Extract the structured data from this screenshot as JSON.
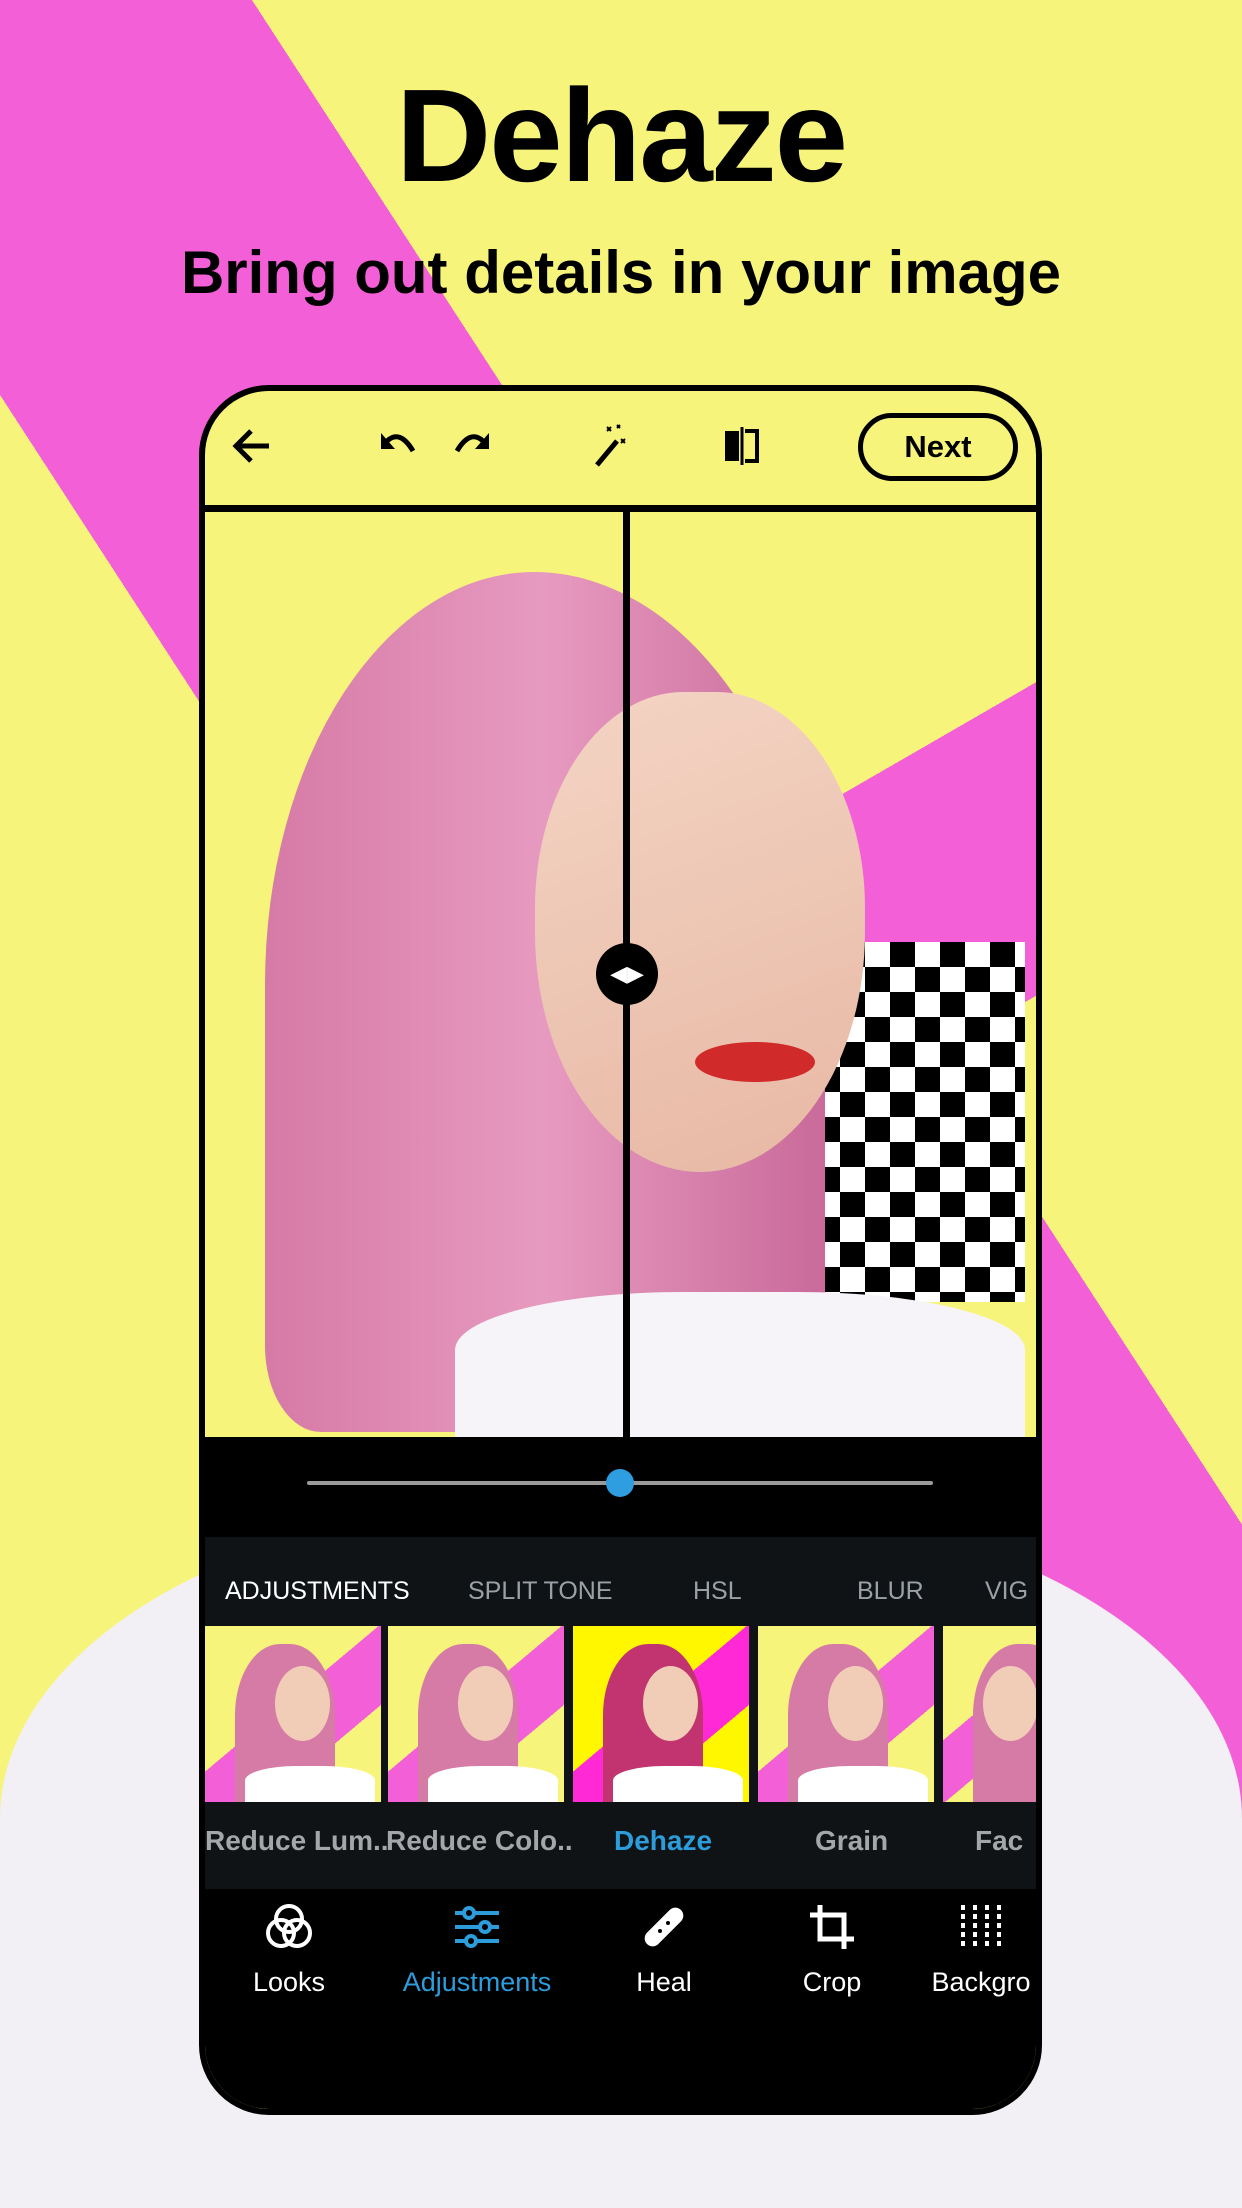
{
  "header": {
    "title": "Dehaze",
    "subtitle": "Bring out details in your image"
  },
  "toolbar": {
    "back_icon": "arrow-left-icon",
    "undo_icon": "undo-icon",
    "redo_icon": "redo-icon",
    "auto_icon": "magic-wand-icon",
    "compare_icon": "compare-icon",
    "next_label": "Next"
  },
  "slider": {
    "value_percent": 50,
    "accent": "#2f9ee0"
  },
  "tabs": [
    {
      "label": "ADJUSTMENTS",
      "active": true
    },
    {
      "label": "SPLIT TONE"
    },
    {
      "label": "HSL"
    },
    {
      "label": "BLUR"
    },
    {
      "label": "VIG"
    }
  ],
  "presets": [
    {
      "label": "Reduce Lum.."
    },
    {
      "label": "Reduce Colo.."
    },
    {
      "label": "Dehaze",
      "selected": true
    },
    {
      "label": "Grain"
    },
    {
      "label": "Fac"
    }
  ],
  "nav": [
    {
      "label": "Looks",
      "icon": "looks-circles-icon"
    },
    {
      "label": "Adjustments",
      "icon": "sliders-icon",
      "active": true
    },
    {
      "label": "Heal",
      "icon": "bandage-icon"
    },
    {
      "label": "Crop",
      "icon": "crop-icon"
    },
    {
      "label": "Backgro",
      "icon": "background-icon"
    }
  ],
  "colors": {
    "background": "#f7f47c",
    "accent_pink": "#f35fd6",
    "selected_blue": "#2d9cdb",
    "panel": "#0f1316"
  }
}
